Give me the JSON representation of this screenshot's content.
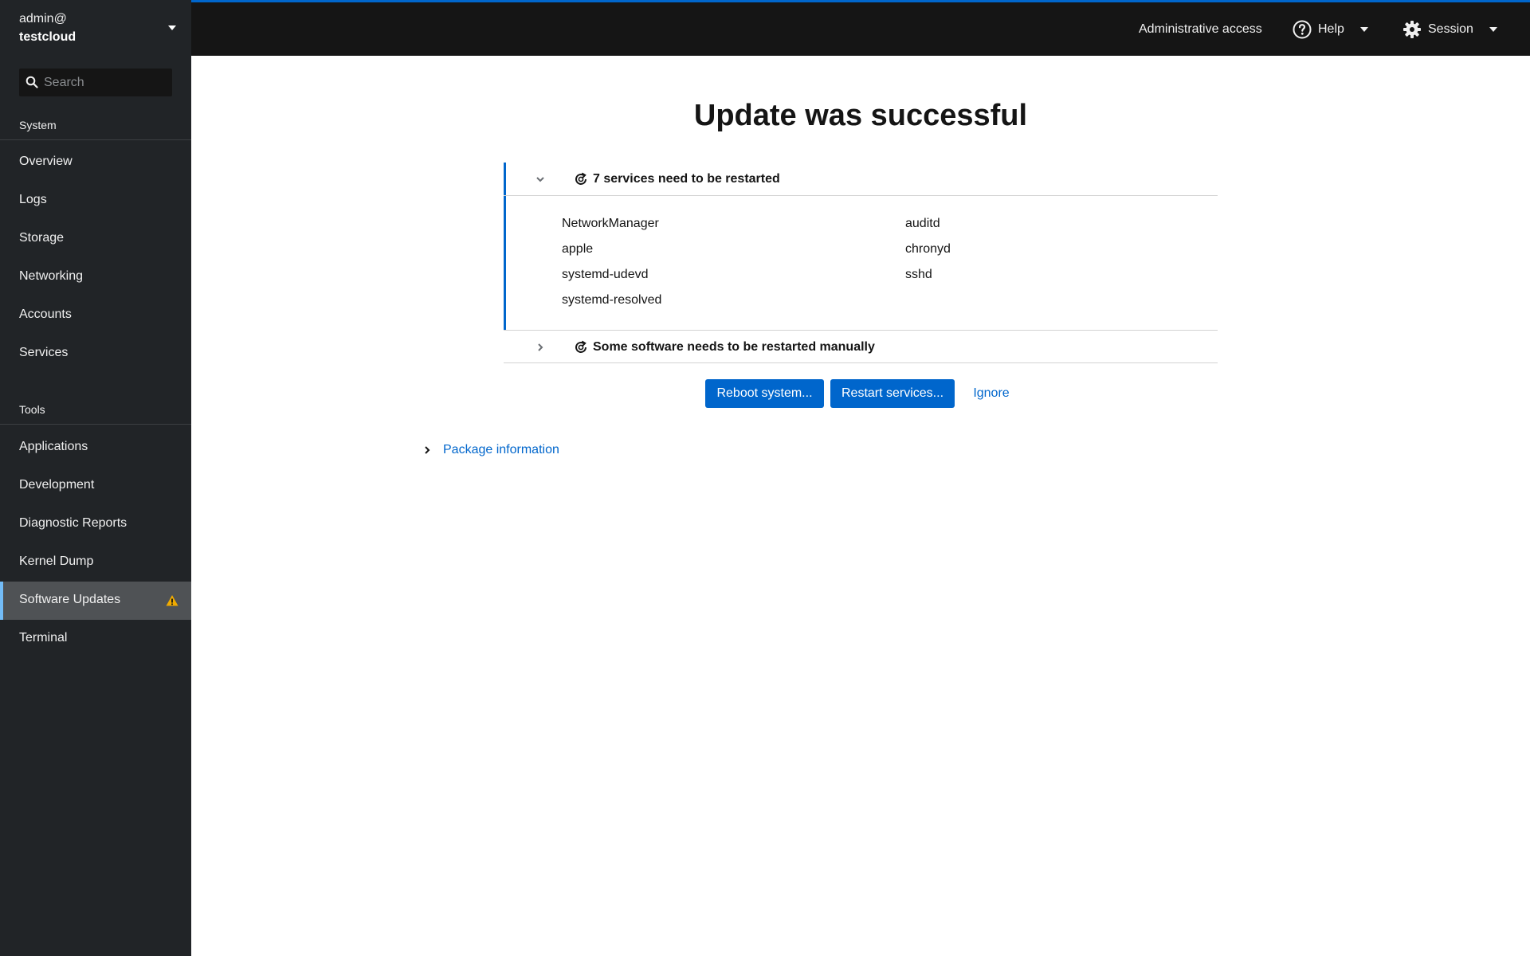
{
  "sidebar": {
    "host_user": "admin@",
    "host_name": "testcloud",
    "search_placeholder": "Search",
    "sections": [
      {
        "title": "System",
        "items": [
          "Overview",
          "Logs",
          "Storage",
          "Networking",
          "Accounts",
          "Services"
        ]
      },
      {
        "title": "Tools",
        "items": [
          "Applications",
          "Development",
          "Diagnostic Reports",
          "Kernel Dump",
          "Software Updates",
          "Terminal"
        ]
      }
    ],
    "active_item": "Software Updates",
    "active_item_badge": "warning-icon"
  },
  "topbar": {
    "admin_access": "Administrative access",
    "help": "Help",
    "session": "Session"
  },
  "main": {
    "title": "Update was successful",
    "restart_services": {
      "title": "7 services need to be restarted",
      "expanded": true,
      "services_left": [
        "NetworkManager",
        "apple",
        "systemd-udevd",
        "systemd-resolved"
      ],
      "services_right": [
        "auditd",
        "chronyd",
        "sshd"
      ]
    },
    "restart_manual": {
      "title": "Some software needs to be restarted manually",
      "expanded": false
    },
    "buttons": {
      "reboot": "Reboot system...",
      "restart": "Restart services...",
      "ignore": "Ignore"
    },
    "package_info": "Package information"
  },
  "colors": {
    "accent": "#0066cc",
    "sidebar_bg": "#212427",
    "topbar_bg": "#151515",
    "active_indicator": "#73bcf7",
    "warning": "#f0ab00"
  }
}
